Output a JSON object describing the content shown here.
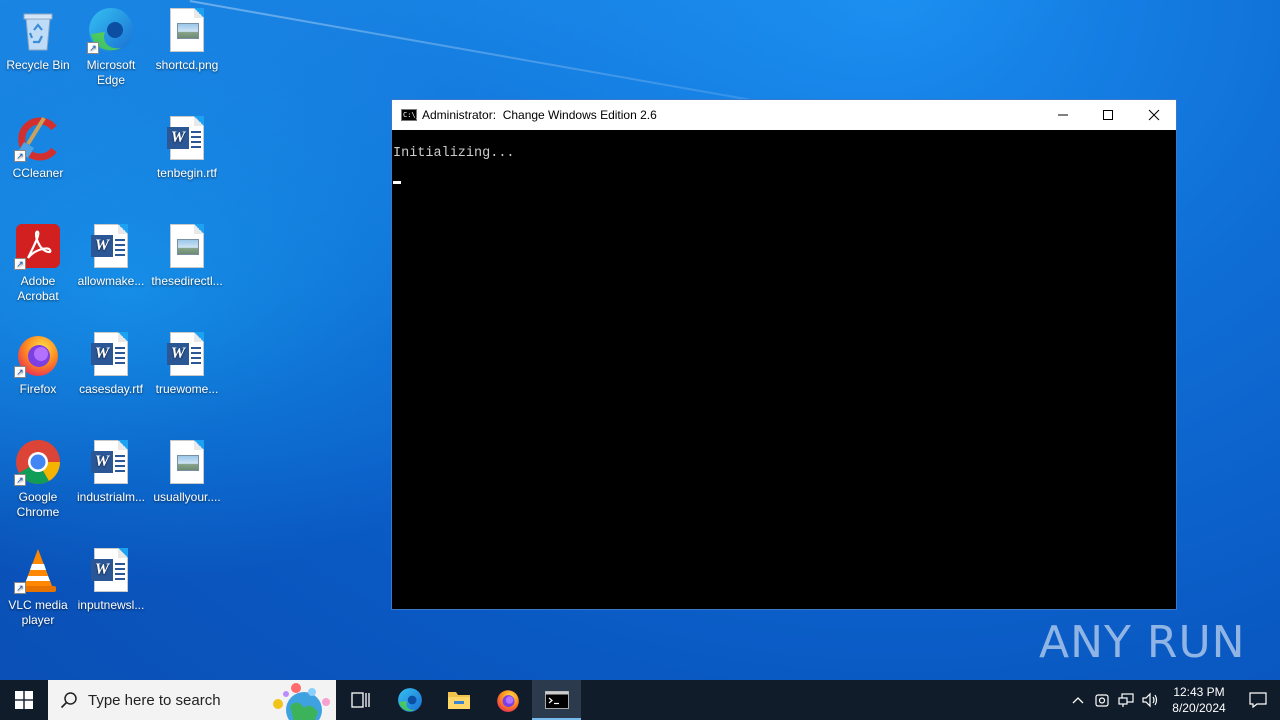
{
  "desktop": {
    "icons": [
      {
        "label": "Recycle Bin"
      },
      {
        "label": "Microsoft Edge"
      },
      {
        "label": "shortcd.png"
      },
      {
        "label": "CCleaner"
      },
      {
        "label": "tenbegin.rtf"
      },
      {
        "label": "Adobe Acrobat"
      },
      {
        "label": "allowmake..."
      },
      {
        "label": "thesedirectl..."
      },
      {
        "label": "Firefox"
      },
      {
        "label": "casesday.rtf"
      },
      {
        "label": "truewome..."
      },
      {
        "label": "Google Chrome"
      },
      {
        "label": "industrialm..."
      },
      {
        "label": "usuallyour...."
      },
      {
        "label": "VLC media player"
      },
      {
        "label": "inputnewsl..."
      }
    ]
  },
  "console": {
    "title": "Administrator:  Change Windows Edition 2.6",
    "icon_text": "C:\\_",
    "output": "Initializing..."
  },
  "watermark": {
    "text": "ANY RUN"
  },
  "taskbar": {
    "search_placeholder": "Type here to search",
    "clock_time": "12:43 PM",
    "clock_date": "8/20/2024"
  },
  "colors": {
    "desktop_bg": "#0f6fd6",
    "taskbar_bg": "#101c2a",
    "console_bg": "#000000",
    "console_text": "#cccccc"
  }
}
